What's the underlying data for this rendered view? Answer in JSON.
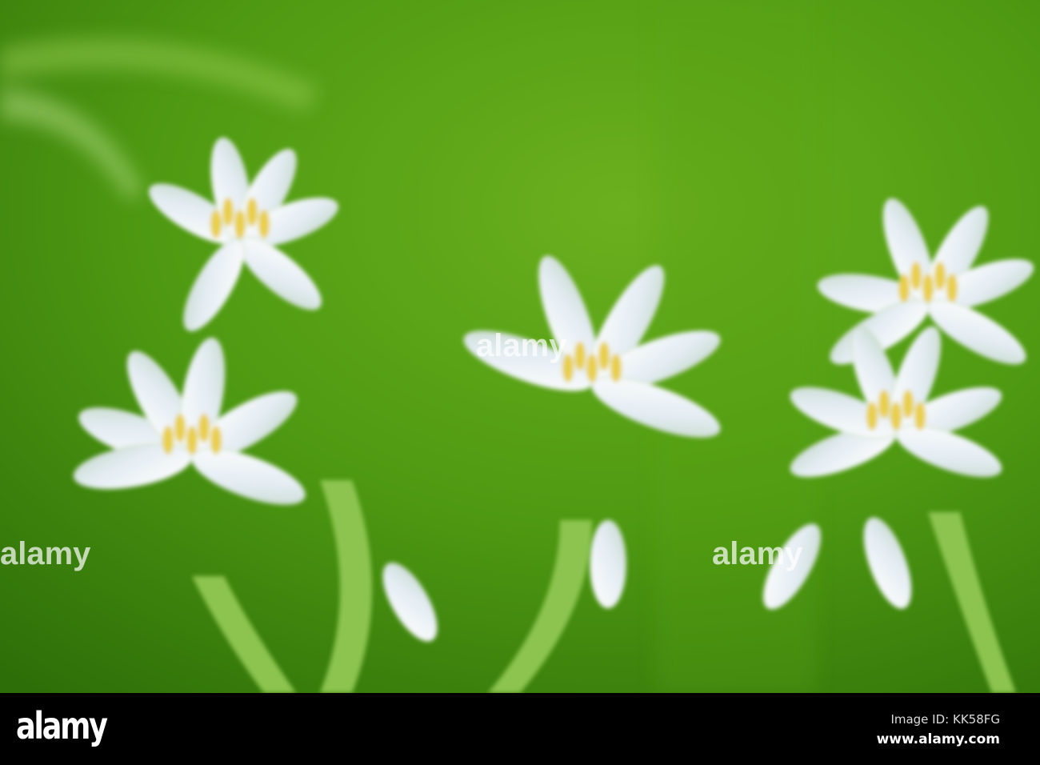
{
  "photo": {
    "subject": "white star-of-Bethlehem flowers",
    "watermark": "alamy"
  },
  "footer": {
    "logo": "alamy",
    "image_id": "Image ID: KK58FG",
    "url": "www.alamy.com"
  },
  "colors": {
    "background_green": "#4f9a12",
    "petal": "#eef3f6",
    "stamen": "#e8cf4a",
    "bar": "#000000"
  }
}
